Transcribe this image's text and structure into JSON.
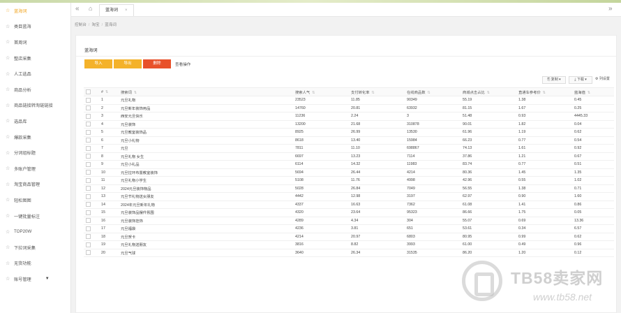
{
  "sidebar": {
    "items": [
      {
        "label": "蓝海词",
        "active": true
      },
      {
        "label": "类目蓝海",
        "active": false
      },
      {
        "label": "首周词",
        "active": false
      },
      {
        "label": "整店采集",
        "active": false
      },
      {
        "label": "人工选品",
        "active": false
      },
      {
        "label": "商品分析",
        "active": false
      },
      {
        "label": "商品链接转淘链链接",
        "active": false
      },
      {
        "label": "选品库",
        "active": false
      },
      {
        "label": "爆款采集",
        "active": false
      },
      {
        "label": "分词组标题",
        "active": false
      },
      {
        "label": "多账户管理",
        "active": false
      },
      {
        "label": "淘宝商品管理",
        "active": false
      },
      {
        "label": "轻松图图",
        "active": false
      },
      {
        "label": "一键批量标注",
        "active": false
      },
      {
        "label": "TOP20W",
        "active": false
      },
      {
        "label": "下拉词采集",
        "active": false
      },
      {
        "label": "无货功能",
        "active": false
      },
      {
        "label": "账号管理",
        "active": false,
        "has_caret": true
      }
    ]
  },
  "tabbar": {
    "collapse_icon": "«",
    "home_icon": "⌂",
    "expand_icon": "»",
    "active_tab": "蓝海词",
    "close_icon": "×"
  },
  "breadcrumb": {
    "items": [
      "控制台",
      "淘宝",
      "蓝海词"
    ],
    "separator": "/"
  },
  "page": {
    "title": "蓝海词",
    "buttons": {
      "import": "导入",
      "export": "导出",
      "delete": "删除"
    },
    "help_link": "查看操作",
    "tools": {
      "restore": "复制",
      "download": "下载",
      "settings": "列设置"
    }
  },
  "table": {
    "headers": [
      "#",
      "搜索词",
      "搜索人气",
      "支付转化率",
      "在线商品数",
      "商城点击占比",
      "直通车参考价",
      "蓝海值"
    ],
    "rows": [
      [
        "1",
        "元旦礼物",
        "23523",
        "11.85",
        "90349",
        "55.19",
        "1.38",
        "0.45"
      ],
      [
        "2",
        "元旦新年装饰用品",
        "14760",
        "20.81",
        "63932",
        "81.15",
        "1.67",
        "0.25"
      ],
      [
        "3",
        "西安元旦快乐",
        "11236",
        "2.24",
        "3",
        "51.48",
        "0.93",
        "4445.33"
      ],
      [
        "4",
        "元旦装饰",
        "13200",
        "21.68",
        "310878",
        "90.01",
        "1.82",
        "0.04"
      ],
      [
        "5",
        "元旦教室装饰品",
        "8925",
        "26.99",
        "13530",
        "61.96",
        "1.19",
        "0.62"
      ],
      [
        "6",
        "元旦小礼物",
        "8618",
        "13.40",
        "15984",
        "66.23",
        "0.77",
        "0.54"
      ],
      [
        "7",
        "元旦",
        "7811",
        "11.10",
        "698867",
        "74.13",
        "1.61",
        "0.92"
      ],
      [
        "8",
        "元旦礼物 女生",
        "6697",
        "13.23",
        "7114",
        "37.86",
        "1.21",
        "0.67"
      ],
      [
        "9",
        "元旦小礼品",
        "6114",
        "14.32",
        "11983",
        "83.74",
        "0.77",
        "0.51"
      ],
      [
        "10",
        "元旦拉环布置教室装饰",
        "5694",
        "26.44",
        "4214",
        "80.36",
        "1.45",
        "1.35"
      ],
      [
        "11",
        "元旦礼物小学生",
        "5108",
        "11.76",
        "4998",
        "42.96",
        "0.55",
        "1.02"
      ],
      [
        "12",
        "2024元旦装饰物品",
        "5028",
        "26.84",
        "7049",
        "56.55",
        "1.38",
        "0.71"
      ],
      [
        "13",
        "元旦节礼物送女朋友",
        "4442",
        "12.98",
        "3197",
        "62.97",
        "0.90",
        "1.60"
      ],
      [
        "14",
        "2024年元旦新年礼物",
        "4337",
        "16.63",
        "7362",
        "61.08",
        "1.41",
        "0.86"
      ],
      [
        "15",
        "元旦装饰品摆件氛围",
        "4320",
        "23.64",
        "95323",
        "86.66",
        "1.75",
        "0.05"
      ],
      [
        "16",
        "元旦装饰挂饰",
        "4289",
        "4.34",
        "304",
        "55.07",
        "0.69",
        "13.36"
      ],
      [
        "17",
        "元旦福袋",
        "4236",
        "3.81",
        "651",
        "53.61",
        "0.34",
        "6.57"
      ],
      [
        "18",
        "元旦贺卡",
        "4214",
        "20.97",
        "6803",
        "80.95",
        "0.99",
        "0.62"
      ],
      [
        "19",
        "元旦礼物送朋友",
        "3816",
        "8.82",
        "3993",
        "61.00",
        "0.49",
        "0.96"
      ],
      [
        "20",
        "元旦气球",
        "3640",
        "26.34",
        "31535",
        "86.20",
        "1.20",
        "0.12"
      ]
    ]
  },
  "watermark": {
    "text": "TB58卖家网",
    "url": "www.tb58.net"
  }
}
